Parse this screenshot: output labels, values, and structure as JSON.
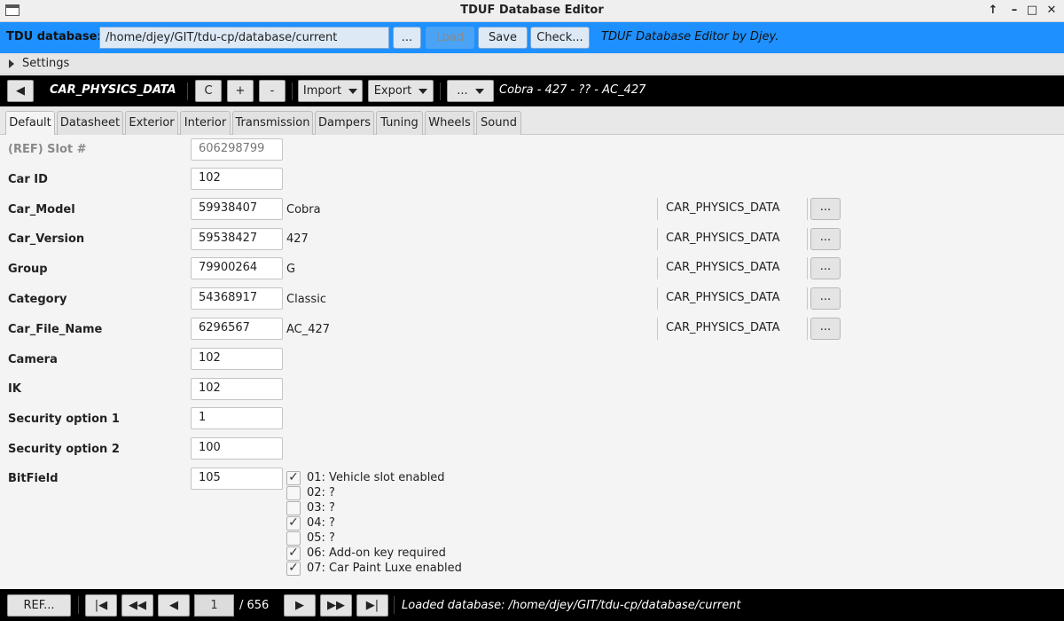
{
  "window": {
    "title": "TDUF Database Editor",
    "controls": {
      "keep_above": "↑",
      "minimize": "–",
      "maximize": "□",
      "close": "✕"
    }
  },
  "db_bar": {
    "label": "TDU database:",
    "path": "/home/djey/GIT/tdu-cp/database/current",
    "browse_label": "...",
    "load_label": "Load",
    "save_label": "Save",
    "check_label": "Check...",
    "credit": "TDUF Database Editor by Djey."
  },
  "settings": {
    "label": "Settings"
  },
  "toolbar": {
    "back_label": "◀",
    "topic": "CAR_PHYSICS_DATA",
    "c_label": "C",
    "plus_label": "+",
    "minus_label": "-",
    "import_label": "Import",
    "export_label": "Export",
    "more_label": "...",
    "car_name": "Cobra - 427 - ?? - AC_427"
  },
  "tabs": [
    {
      "label": "Default",
      "active": true
    },
    {
      "label": "Datasheet"
    },
    {
      "label": "Exterior"
    },
    {
      "label": "Interior"
    },
    {
      "label": "Transmission"
    },
    {
      "label": "Dampers"
    },
    {
      "label": "Tuning"
    },
    {
      "label": "Wheels"
    },
    {
      "label": "Sound"
    }
  ],
  "fields": [
    {
      "label": "(REF) Slot #",
      "value": "606298799"
    },
    {
      "label": "Car ID",
      "value": "102"
    },
    {
      "label": "Car_Model",
      "value": "59938407",
      "resolved": "Cobra",
      "topic": "CAR_PHYSICS_DATA",
      "btn": "..."
    },
    {
      "label": "Car_Version",
      "value": "59538427",
      "resolved": "427",
      "topic": "CAR_PHYSICS_DATA",
      "btn": "..."
    },
    {
      "label": "Group",
      "value": "79900264",
      "resolved": "G",
      "topic": "CAR_PHYSICS_DATA",
      "btn": "..."
    },
    {
      "label": "Category",
      "value": "54368917",
      "resolved": "Classic",
      "topic": "CAR_PHYSICS_DATA",
      "btn": "..."
    },
    {
      "label": "Car_File_Name",
      "value": "6296567",
      "resolved": "AC_427",
      "topic": "CAR_PHYSICS_DATA",
      "btn": "..."
    },
    {
      "label": "Camera",
      "value": "102"
    },
    {
      "label": "IK",
      "value": "102"
    },
    {
      "label": "Security option 1",
      "value": "1"
    },
    {
      "label": "Security option 2",
      "value": "100"
    },
    {
      "label": "BitField",
      "value": "105"
    }
  ],
  "bits": [
    {
      "label": "01: Vehicle slot enabled",
      "checked": true
    },
    {
      "label": "02: ?",
      "checked": false
    },
    {
      "label": "03: ?",
      "checked": false
    },
    {
      "label": "04: ?",
      "checked": true
    },
    {
      "label": "05: ?",
      "checked": false
    },
    {
      "label": "06: Add-on key required",
      "checked": true
    },
    {
      "label": "07: Car Paint Luxe enabled",
      "checked": true
    }
  ],
  "status": {
    "ref_label": "REF...",
    "first_label": "|◀",
    "prev_fast_label": "◀◀",
    "prev_label": "◀",
    "page": "1",
    "page_count": "/ 656",
    "next_label": "▶",
    "next_fast_label": "▶▶",
    "last_label": "▶|",
    "message": "Loaded database: /home/djey/GIT/tdu-cp/database/current"
  },
  "colors": {
    "accent": "#1e90ff",
    "toolbar": "#000000"
  }
}
